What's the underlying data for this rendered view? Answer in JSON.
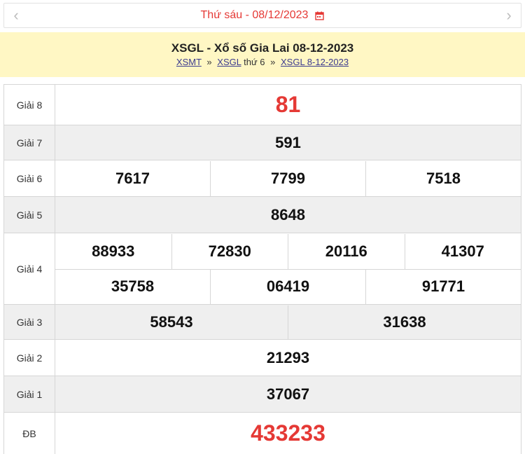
{
  "datebar": {
    "date_text": "Thứ sáu -  08/12/2023",
    "prev_arrow": "‹",
    "next_arrow": "›"
  },
  "header": {
    "title": "XSGL - Xổ số Gia Lai 08-12-2023",
    "breadcrumb": {
      "link1": "XSMT",
      "sep1": "»",
      "link2": "XSGL",
      "text2": "thứ 6",
      "sep2": "»",
      "link3": "XSGL 8-12-2023"
    }
  },
  "prizes": {
    "g8": {
      "label": "Giải 8",
      "numbers": [
        "81"
      ]
    },
    "g7": {
      "label": "Giải 7",
      "numbers": [
        "591"
      ]
    },
    "g6": {
      "label": "Giải 6",
      "numbers": [
        "7617",
        "7799",
        "7518"
      ]
    },
    "g5": {
      "label": "Giải 5",
      "numbers": [
        "8648"
      ]
    },
    "g4": {
      "label": "Giải 4",
      "row1": [
        "88933",
        "72830",
        "20116",
        "41307"
      ],
      "row2": [
        "35758",
        "06419",
        "91771"
      ]
    },
    "g3": {
      "label": "Giải 3",
      "numbers": [
        "58543",
        "31638"
      ]
    },
    "g2": {
      "label": "Giải 2",
      "numbers": [
        "21293"
      ]
    },
    "g1": {
      "label": "Giải 1",
      "numbers": [
        "37067"
      ]
    },
    "db": {
      "label": "ĐB",
      "numbers": [
        "433233"
      ]
    }
  },
  "colors": {
    "accent_red": "#e53935",
    "header_bg": "#fff7c4",
    "row_gray": "#efefef",
    "link": "#3b3b8f"
  }
}
